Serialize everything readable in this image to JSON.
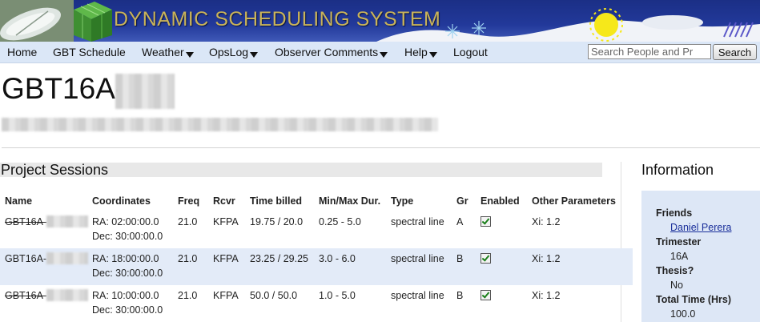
{
  "banner": {
    "title": "DYNAMIC SCHEDULING SYSTEM"
  },
  "nav": {
    "items": [
      {
        "label": "Home",
        "dropdown": false
      },
      {
        "label": "GBT Schedule",
        "dropdown": false
      },
      {
        "label": "Weather",
        "dropdown": true
      },
      {
        "label": "OpsLog",
        "dropdown": true
      },
      {
        "label": "Observer Comments",
        "dropdown": true
      },
      {
        "label": "Help",
        "dropdown": true
      },
      {
        "label": "Logout",
        "dropdown": false
      }
    ],
    "search_placeholder": "Search People and Pr",
    "search_button": "Search"
  },
  "page": {
    "title": "GBT16A-"
  },
  "sessions": {
    "heading": "Project Sessions",
    "columns": [
      "Name",
      "Coordinates",
      "Freq",
      "Rcvr",
      "Time billed",
      "Min/Max Dur.",
      "Type",
      "Gr",
      "Enabled",
      "Other Parameters"
    ],
    "rows": [
      {
        "name": "GBT16A-",
        "struck": true,
        "ra": "RA: 02:00:00.0",
        "dec": "Dec: 30:00:00.0",
        "freq": "21.0",
        "rcvr": "KFPA",
        "time_billed": "19.75 / 20.0",
        "dur": "0.25 - 5.0",
        "type": "spectral line",
        "gr": "A",
        "enabled": true,
        "other": "Xi: 1.2"
      },
      {
        "name": "GBT16A-",
        "struck": false,
        "ra": "RA: 18:00:00.0",
        "dec": "Dec: 30:00:00.0",
        "freq": "21.0",
        "rcvr": "KFPA",
        "time_billed": "23.25 / 29.25",
        "dur": "3.0 - 6.0",
        "type": "spectral line",
        "gr": "B",
        "enabled": true,
        "other": "Xi: 1.2"
      },
      {
        "name": "GBT16A-",
        "struck": true,
        "ra": "RA: 10:00:00.0",
        "dec": "Dec: 30:00:00.0",
        "freq": "21.0",
        "rcvr": "KFPA",
        "time_billed": "50.0 / 50.0",
        "dur": "1.0 - 5.0",
        "type": "spectral line",
        "gr": "B",
        "enabled": true,
        "other": "Xi: 1.2"
      }
    ]
  },
  "info": {
    "heading": "Information",
    "friends_label": "Friends",
    "friend_name": "Daniel Perera",
    "trimester_label": "Trimester",
    "trimester_value": "16A",
    "thesis_label": "Thesis?",
    "thesis_value": "No",
    "total_time_label": "Total Time (Hrs)",
    "total_time_value": "100.0"
  }
}
